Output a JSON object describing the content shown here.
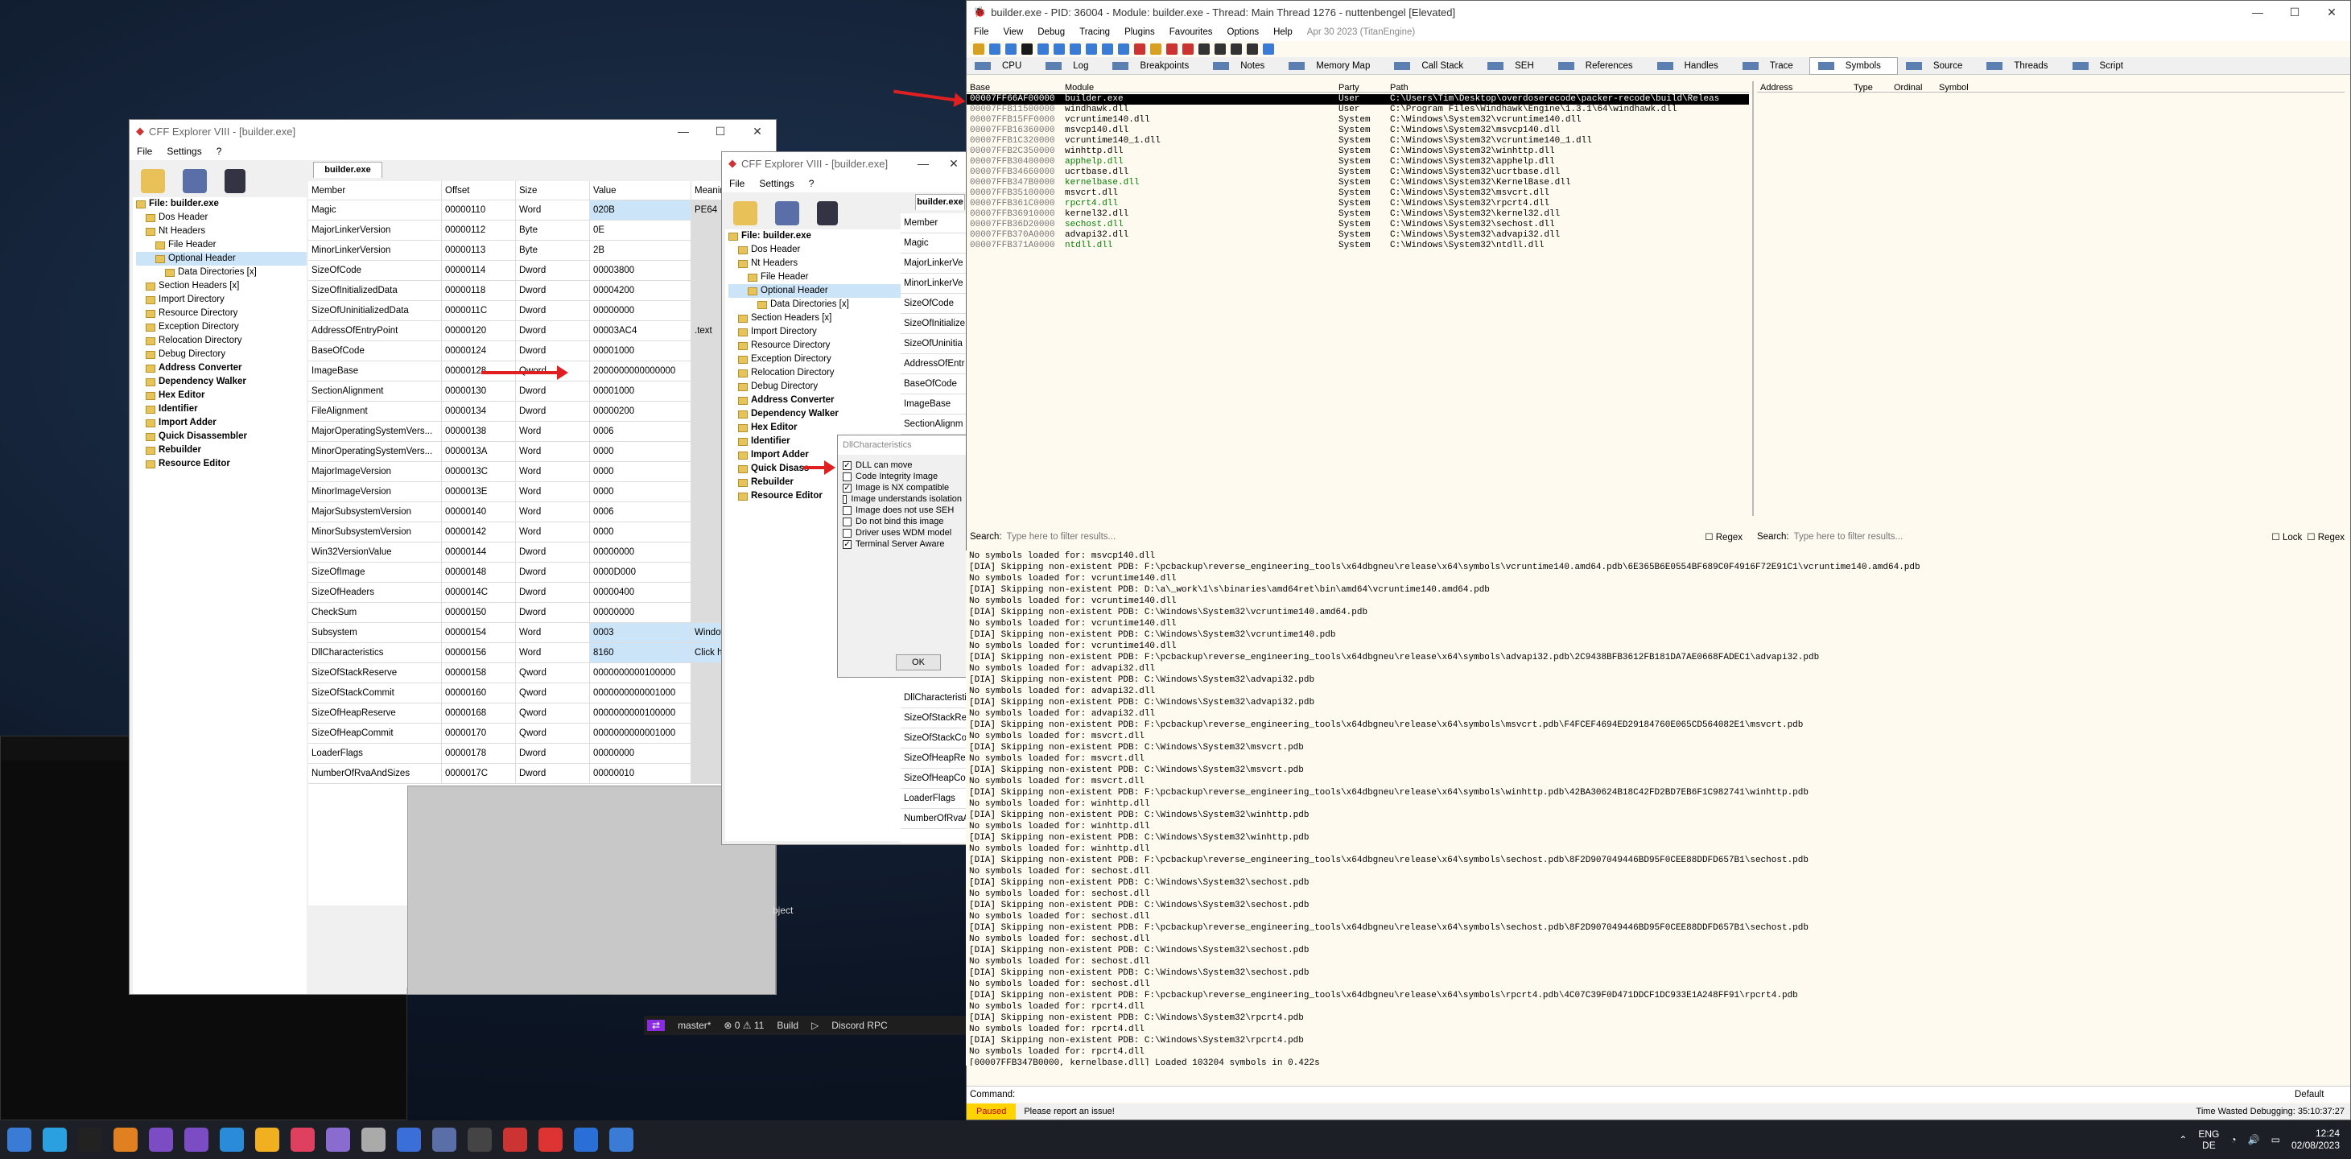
{
  "cff1": {
    "title": "CFF Explorer VIII - [builder.exe]",
    "menus": [
      "File",
      "Settings",
      "?"
    ],
    "tab": "builder.exe",
    "tree": [
      {
        "label": "File: builder.exe",
        "bold": true
      },
      {
        "label": "Dos Header"
      },
      {
        "label": "Nt Headers"
      },
      {
        "label": "File Header"
      },
      {
        "label": "Optional Header",
        "sel": true
      },
      {
        "label": "Data Directories [x]"
      },
      {
        "label": "Section Headers [x]"
      },
      {
        "label": "Import Directory"
      },
      {
        "label": "Resource Directory"
      },
      {
        "label": "Exception Directory"
      },
      {
        "label": "Relocation Directory"
      },
      {
        "label": "Debug Directory"
      },
      {
        "label": "Address Converter",
        "bold": true
      },
      {
        "label": "Dependency Walker",
        "bold": true
      },
      {
        "label": "Hex Editor",
        "bold": true
      },
      {
        "label": "Identifier",
        "bold": true
      },
      {
        "label": "Import Adder",
        "bold": true
      },
      {
        "label": "Quick Disassembler",
        "bold": true
      },
      {
        "label": "Rebuilder",
        "bold": true
      },
      {
        "label": "Resource Editor",
        "bold": true
      }
    ],
    "columns": [
      "Member",
      "Offset",
      "Size",
      "Value",
      "Meaning"
    ],
    "rows": [
      [
        "Magic",
        "00000110",
        "Word",
        "020B",
        "PE64"
      ],
      [
        "MajorLinkerVersion",
        "00000112",
        "Byte",
        "0E",
        ""
      ],
      [
        "MinorLinkerVersion",
        "00000113",
        "Byte",
        "2B",
        ""
      ],
      [
        "SizeOfCode",
        "00000114",
        "Dword",
        "00003800",
        ""
      ],
      [
        "SizeOfInitializedData",
        "00000118",
        "Dword",
        "00004200",
        ""
      ],
      [
        "SizeOfUninitializedData",
        "0000011C",
        "Dword",
        "00000000",
        ""
      ],
      [
        "AddressOfEntryPoint",
        "00000120",
        "Dword",
        "00003AC4",
        ".text"
      ],
      [
        "BaseOfCode",
        "00000124",
        "Dword",
        "00001000",
        ""
      ],
      [
        "ImageBase",
        "00000128",
        "Qword",
        "2000000000000000",
        ""
      ],
      [
        "SectionAlignment",
        "00000130",
        "Dword",
        "00001000",
        ""
      ],
      [
        "FileAlignment",
        "00000134",
        "Dword",
        "00000200",
        ""
      ],
      [
        "MajorOperatingSystemVers...",
        "00000138",
        "Word",
        "0006",
        ""
      ],
      [
        "MinorOperatingSystemVers...",
        "0000013A",
        "Word",
        "0000",
        ""
      ],
      [
        "MajorImageVersion",
        "0000013C",
        "Word",
        "0000",
        ""
      ],
      [
        "MinorImageVersion",
        "0000013E",
        "Word",
        "0000",
        ""
      ],
      [
        "MajorSubsystemVersion",
        "00000140",
        "Word",
        "0006",
        ""
      ],
      [
        "MinorSubsystemVersion",
        "00000142",
        "Word",
        "0000",
        ""
      ],
      [
        "Win32VersionValue",
        "00000144",
        "Dword",
        "00000000",
        ""
      ],
      [
        "SizeOfImage",
        "00000148",
        "Dword",
        "0000D000",
        ""
      ],
      [
        "SizeOfHeaders",
        "0000014C",
        "Dword",
        "00000400",
        ""
      ],
      [
        "CheckSum",
        "00000150",
        "Dword",
        "00000000",
        ""
      ],
      [
        "Subsystem",
        "00000154",
        "Word",
        "0003",
        "Windows"
      ],
      [
        "DllCharacteristics",
        "00000156",
        "Word",
        "8160",
        "Click here"
      ],
      [
        "SizeOfStackReserve",
        "00000158",
        "Qword",
        "0000000000100000",
        ""
      ],
      [
        "SizeOfStackCommit",
        "00000160",
        "Qword",
        "0000000000001000",
        ""
      ],
      [
        "SizeOfHeapReserve",
        "00000168",
        "Qword",
        "0000000000100000",
        ""
      ],
      [
        "SizeOfHeapCommit",
        "00000170",
        "Qword",
        "0000000000001000",
        ""
      ],
      [
        "LoaderFlags",
        "00000178",
        "Dword",
        "00000000",
        ""
      ],
      [
        "NumberOfRvaAndSizes",
        "0000017C",
        "Dword",
        "00000010",
        ""
      ]
    ]
  },
  "cff2": {
    "title": "CFF Explorer VIII - [builder.exe]",
    "menus": [
      "File",
      "Settings",
      "?"
    ],
    "tab": "builder.exe",
    "tree": [
      {
        "label": "File: builder.exe",
        "bold": true
      },
      {
        "label": "Dos Header"
      },
      {
        "label": "Nt Headers"
      },
      {
        "label": "File Header"
      },
      {
        "label": "Optional Header",
        "sel": true
      },
      {
        "label": "Data Directories [x]"
      },
      {
        "label": "Section Headers [x]"
      },
      {
        "label": "Import Directory"
      },
      {
        "label": "Resource Directory"
      },
      {
        "label": "Exception Directory"
      },
      {
        "label": "Relocation Directory"
      },
      {
        "label": "Debug Directory"
      },
      {
        "label": "Address Converter",
        "bold": true
      },
      {
        "label": "Dependency Walker",
        "bold": true
      },
      {
        "label": "Hex Editor",
        "bold": true
      },
      {
        "label": "Identifier",
        "bold": true
      },
      {
        "label": "Import Adder",
        "bold": true
      },
      {
        "label": "Quick Disass",
        "bold": true
      },
      {
        "label": "Rebuilder",
        "bold": true
      },
      {
        "label": "Resource Editor",
        "bold": true
      }
    ],
    "members": [
      "Member",
      "Magic",
      "MajorLinkerVe",
      "MinorLinkerVe",
      "SizeOfCode",
      "SizeOfInitialize",
      "SizeOfUninitia",
      "AddressOfEntr",
      "BaseOfCode",
      "ImageBase",
      "SectionAlignm"
    ],
    "members_low": [
      "DllCharacteristi",
      "SizeOfStackRe",
      "SizeOfStackCo",
      "SizeOfHeapRe",
      "SizeOfHeapCo",
      "LoaderFlags",
      "NumberOfRvaA"
    ]
  },
  "dll_dialog": {
    "title": "DllCharacteristics",
    "ok": "OK",
    "options": [
      {
        "label": "DLL can move",
        "checked": true
      },
      {
        "label": "Code Integrity Image",
        "checked": false
      },
      {
        "label": "Image is NX compatible",
        "checked": true
      },
      {
        "label": "Image understands isolation",
        "checked": false
      },
      {
        "label": "Image does not use SEH",
        "checked": false
      },
      {
        "label": "Do not bind this image",
        "checked": false
      },
      {
        "label": "Driver uses WDM model",
        "checked": false
      },
      {
        "label": "Terminal Server Aware",
        "checked": true
      }
    ]
  },
  "x64dbg": {
    "title": "builder.exe - PID: 36004 - Module: builder.exe - Thread: Main Thread 1276 - nuttenbengel [Elevated]",
    "menus": [
      "File",
      "View",
      "Debug",
      "Tracing",
      "Plugins",
      "Favourites",
      "Options",
      "Help",
      "Apr 30 2023 (TitanEngine)"
    ],
    "tabs": [
      "CPU",
      "Log",
      "Breakpoints",
      "Notes",
      "Memory Map",
      "Call Stack",
      "SEH",
      "References",
      "Handles",
      "Trace",
      "Symbols",
      "Source",
      "Threads",
      "Script"
    ],
    "active_tab": "Symbols",
    "mod_columns": [
      "Base",
      "Module",
      "Party",
      "Path"
    ],
    "sym_columns": [
      "Address",
      "Type",
      "Ordinal",
      "Symbol"
    ],
    "modules": [
      [
        "00007FF66AF00000",
        "builder.exe",
        "User",
        "C:\\Users\\Tim\\Desktop\\overdoserecode\\packer-recode\\build\\Releas"
      ],
      [
        "00007FFB11500000",
        "windhawk.dll",
        "User",
        "C:\\Program Files\\Windhawk\\Engine\\1.3.1\\64\\windhawk.dll"
      ],
      [
        "00007FFB15FF0000",
        "vcruntime140.dll",
        "System",
        "C:\\Windows\\System32\\vcruntime140.dll"
      ],
      [
        "00007FFB16360000",
        "msvcp140.dll",
        "System",
        "C:\\Windows\\System32\\msvcp140.dll"
      ],
      [
        "00007FFB1C320000",
        "vcruntime140_1.dll",
        "System",
        "C:\\Windows\\System32\\vcruntime140_1.dll"
      ],
      [
        "00007FFB2C350000",
        "winhttp.dll",
        "System",
        "C:\\Windows\\System32\\winhttp.dll"
      ],
      [
        "00007FFB30400000",
        "apphelp.dll",
        "System",
        "C:\\Windows\\System32\\apphelp.dll"
      ],
      [
        "00007FFB34660000",
        "ucrtbase.dll",
        "System",
        "C:\\Windows\\System32\\ucrtbase.dll"
      ],
      [
        "00007FFB347B0000",
        "kernelbase.dll",
        "System",
        "C:\\Windows\\System32\\KernelBase.dll"
      ],
      [
        "00007FFB35100000",
        "msvcrt.dll",
        "System",
        "C:\\Windows\\System32\\msvcrt.dll"
      ],
      [
        "00007FFB361C0000",
        "rpcrt4.dll",
        "System",
        "C:\\Windows\\System32\\rpcrt4.dll"
      ],
      [
        "00007FFB36910000",
        "kernel32.dll",
        "System",
        "C:\\Windows\\System32\\kernel32.dll"
      ],
      [
        "00007FFB36D20000",
        "sechost.dll",
        "System",
        "C:\\Windows\\System32\\sechost.dll"
      ],
      [
        "00007FFB370A0000",
        "advapi32.dll",
        "System",
        "C:\\Windows\\System32\\advapi32.dll"
      ],
      [
        "00007FFB371A0000",
        "ntdll.dll",
        "System",
        "C:\\Windows\\System32\\ntdll.dll"
      ]
    ],
    "search_label": "Search:",
    "search_placeholder": "Type here to filter results...",
    "regex": "Regex",
    "lock": "Lock",
    "log": [
      "No symbols loaded for: msvcp140.dll",
      "[DIA] Skipping non-existent PDB: F:\\pcbackup\\reverse_engineering_tools\\x64dbgneu\\release\\x64\\symbols\\vcruntime140.amd64.pdb\\6E365B6E0554BF689C0F4916F72E91C1\\vcruntime140.amd64.pdb",
      "No symbols loaded for: vcruntime140.dll",
      "[DIA] Skipping non-existent PDB: D:\\a\\_work\\1\\s\\binaries\\amd64ret\\bin\\amd64\\vcruntime140.amd64.pdb",
      "No symbols loaded for: vcruntime140.dll",
      "[DIA] Skipping non-existent PDB: C:\\Windows\\System32\\vcruntime140.amd64.pdb",
      "No symbols loaded for: vcruntime140.dll",
      "[DIA] Skipping non-existent PDB: C:\\Windows\\System32\\vcruntime140.pdb",
      "No symbols loaded for: vcruntime140.dll",
      "[DIA] Skipping non-existent PDB: F:\\pcbackup\\reverse_engineering_tools\\x64dbgneu\\release\\x64\\symbols\\advapi32.pdb\\2C9438BFB3612FB181DA7AE0668FADEC1\\advapi32.pdb",
      "No symbols loaded for: advapi32.dll",
      "[DIA] Skipping non-existent PDB: C:\\Windows\\System32\\advapi32.pdb",
      "No symbols loaded for: advapi32.dll",
      "[DIA] Skipping non-existent PDB: C:\\Windows\\System32\\advapi32.pdb",
      "No symbols loaded for: advapi32.dll",
      "[DIA] Skipping non-existent PDB: F:\\pcbackup\\reverse_engineering_tools\\x64dbgneu\\release\\x64\\symbols\\msvcrt.pdb\\F4FCEF4694ED29184760E065CD564082E1\\msvcrt.pdb",
      "No symbols loaded for: msvcrt.dll",
      "[DIA] Skipping non-existent PDB: C:\\Windows\\System32\\msvcrt.pdb",
      "No symbols loaded for: msvcrt.dll",
      "[DIA] Skipping non-existent PDB: C:\\Windows\\System32\\msvcrt.pdb",
      "No symbols loaded for: msvcrt.dll",
      "[DIA] Skipping non-existent PDB: F:\\pcbackup\\reverse_engineering_tools\\x64dbgneu\\release\\x64\\symbols\\winhttp.pdb\\42BA30624B18C42FD2BD7EB6F1C982741\\winhttp.pdb",
      "No symbols loaded for: winhttp.dll",
      "[DIA] Skipping non-existent PDB: C:\\Windows\\System32\\winhttp.pdb",
      "No symbols loaded for: winhttp.dll",
      "[DIA] Skipping non-existent PDB: C:\\Windows\\System32\\winhttp.pdb",
      "No symbols loaded for: winhttp.dll",
      "[DIA] Skipping non-existent PDB: F:\\pcbackup\\reverse_engineering_tools\\x64dbgneu\\release\\x64\\symbols\\sechost.pdb\\8F2D907049446BD95F0CEE88DDFD657B1\\sechost.pdb",
      "No symbols loaded for: sechost.dll",
      "[DIA] Skipping non-existent PDB: C:\\Windows\\System32\\sechost.pdb",
      "No symbols loaded for: sechost.dll",
      "[DIA] Skipping non-existent PDB: C:\\Windows\\System32\\sechost.pdb",
      "No symbols loaded for: sechost.dll",
      "[DIA] Skipping non-existent PDB: F:\\pcbackup\\reverse_engineering_tools\\x64dbgneu\\release\\x64\\symbols\\sechost.pdb\\8F2D907049446BD95F0CEE88DDFD657B1\\sechost.pdb",
      "No symbols loaded for: sechost.dll",
      "[DIA] Skipping non-existent PDB: C:\\Windows\\System32\\sechost.pdb",
      "No symbols loaded for: sechost.dll",
      "[DIA] Skipping non-existent PDB: C:\\Windows\\System32\\sechost.pdb",
      "No symbols loaded for: sechost.dll",
      "[DIA] Skipping non-existent PDB: F:\\pcbackup\\reverse_engineering_tools\\x64dbgneu\\release\\x64\\symbols\\rpcrt4.pdb\\4C07C39F0D471DDCF1DC933E1A248FF91\\rpcrt4.pdb",
      "No symbols loaded for: rpcrt4.dll",
      "[DIA] Skipping non-existent PDB: C:\\Windows\\System32\\rpcrt4.pdb",
      "No symbols loaded for: rpcrt4.dll",
      "[DIA] Skipping non-existent PDB: C:\\Windows\\System32\\rpcrt4.pdb",
      "No symbols loaded for: rpcrt4.dll",
      "[00007FFB347B0000, kernelbase.dll] Loaded 103204 symbols in 0.422s"
    ],
    "command_label": "Command:",
    "command_mode": "Default",
    "status": "Paused",
    "status_msg": "Please report an issue!",
    "time_wasted": "Time Wasted Debugging: 35:10:37:27"
  },
  "vscode_status": {
    "branch": "master*",
    "problems": "⊗ 0 ⚠ 11",
    "build": "Build",
    "discord": "Discord RPC",
    "object": "bject"
  },
  "taskbar": {
    "lang_top": "ENG",
    "lang_bottom": "DE",
    "time": "12:24",
    "date": "02/08/2023"
  },
  "colors": {
    "selected_row": "#cce4f7",
    "paused": "#ffd400",
    "arrow": "#e02020",
    "user": "#000000",
    "system_green": "#008000"
  }
}
